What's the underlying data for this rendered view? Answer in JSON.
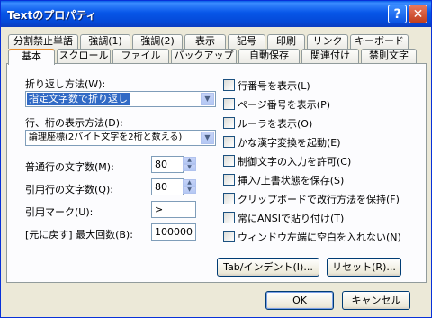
{
  "window": {
    "title": "Textのプロパティ",
    "help_label": "?",
    "close_label": "✕"
  },
  "tabs_row1": [
    "分割禁止単語",
    "強調(1)",
    "強調(2)",
    "表示",
    "記号",
    "印刷",
    "リンク",
    "キーボード"
  ],
  "tabs_row2": [
    "基本",
    "スクロール",
    "ファイル",
    "バックアップ",
    "自動保存",
    "関連付け",
    "禁則文字"
  ],
  "active_tab": "基本",
  "wrap_method": {
    "label": "折り返し方法(W):",
    "value": "指定文字数で折り返し"
  },
  "line_digit": {
    "label": "行、桁の表示方法(D):",
    "value": "論理座標(2バイト文字を2桁と数える)"
  },
  "normal_line_chars": {
    "label": "普通行の文字数(M):",
    "value": "80"
  },
  "quote_line_chars": {
    "label": "引用行の文字数(Q):",
    "value": "80"
  },
  "quote_mark": {
    "label": "引用マーク(U):",
    "value": ">"
  },
  "undo_max": {
    "label": "[元に戻す] 最大回数(B):",
    "value": "100000"
  },
  "checkboxes": [
    "行番号を表示(L)",
    "ページ番号を表示(P)",
    "ルーラを表示(O)",
    "かな漢字変換を起動(E)",
    "制御文字の入力を許可(C)",
    "挿入/上書状態を保存(S)",
    "クリップボードで改行方法を保持(F)",
    "常にANSIで貼り付け(T)",
    "ウィンドウ左端に空白を入れない(N)"
  ],
  "buttons": {
    "tab_indent": "Tab/インデント(I)...",
    "reset": "リセット(R)...",
    "ok": "OK",
    "cancel": "キャンセル"
  }
}
